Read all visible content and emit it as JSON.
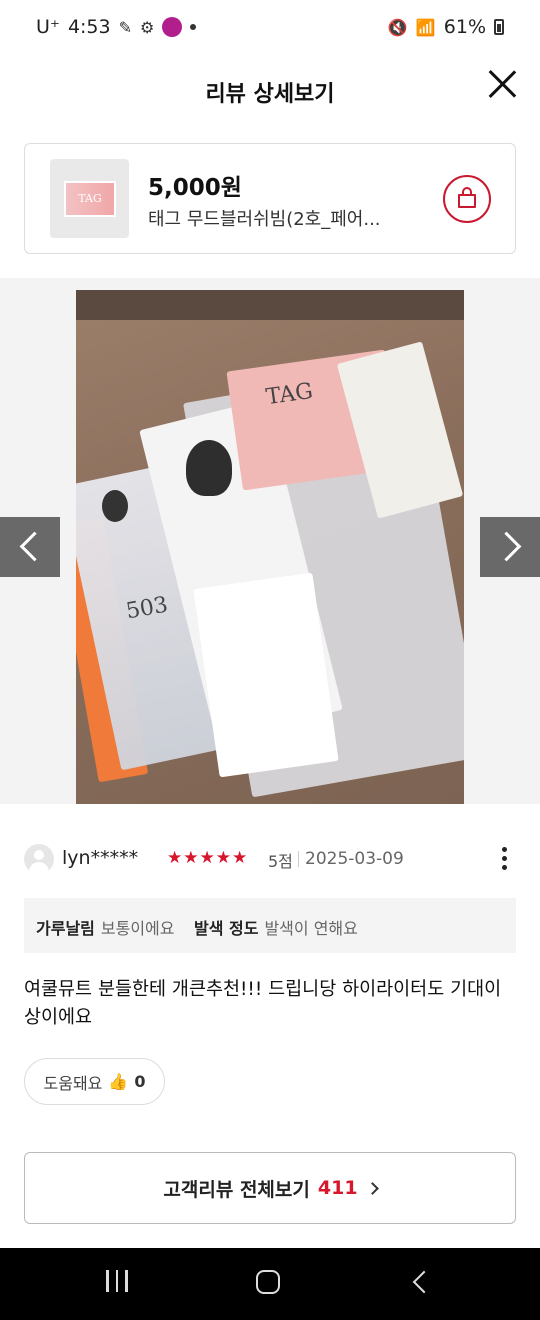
{
  "status_bar": {
    "carrier": "U⁺",
    "time": "4:53",
    "battery": "61%"
  },
  "header": {
    "title": "리뷰 상세보기"
  },
  "product": {
    "thumb_text": "TAG",
    "price": "5,000원",
    "name": "태그 무드블러쉬빔(2호_페어..."
  },
  "viewer": {
    "photo_labels": {
      "brand": "TAG",
      "model": "503"
    }
  },
  "review": {
    "user": "lyn*****",
    "stars": [
      "★",
      "★",
      "★",
      "★",
      "★"
    ],
    "score": "5점",
    "date": "2025-03-09",
    "attributes": [
      {
        "key": "가루날림",
        "value": "보통이에요"
      },
      {
        "key": "발색 정도",
        "value": "발색이 연해요"
      }
    ],
    "text": "여쿨뮤트 분들한테 개큰추천!!! 드립니당 하이라이터도 기대이상이에요",
    "helpful_label": "도움돼요",
    "helpful_count": "0"
  },
  "all_reviews": {
    "label": "고객리뷰 전체보기",
    "count": "411"
  },
  "colors": {
    "accent": "#d6172d"
  }
}
